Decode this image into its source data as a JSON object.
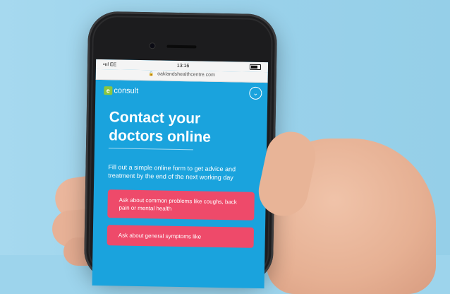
{
  "status_bar": {
    "carrier": "•ııl EE",
    "time": "13:16"
  },
  "browser": {
    "url": "oaklandshealthcentre.com"
  },
  "brand": {
    "logo_letter": "e",
    "logo_text": "consult"
  },
  "page": {
    "headline_line1": "Contact your",
    "headline_line2": "doctors online",
    "description": "Fill out a simple online form to get advice and treatment by the end of the next working day",
    "buttons": [
      {
        "label": "Ask about common problems like coughs, back pain or mental health"
      },
      {
        "label": "Ask about general symptoms like"
      }
    ]
  },
  "colors": {
    "accent": "#1aa3dd",
    "cta": "#ee4a6a",
    "logo_green": "#8cc63f"
  }
}
